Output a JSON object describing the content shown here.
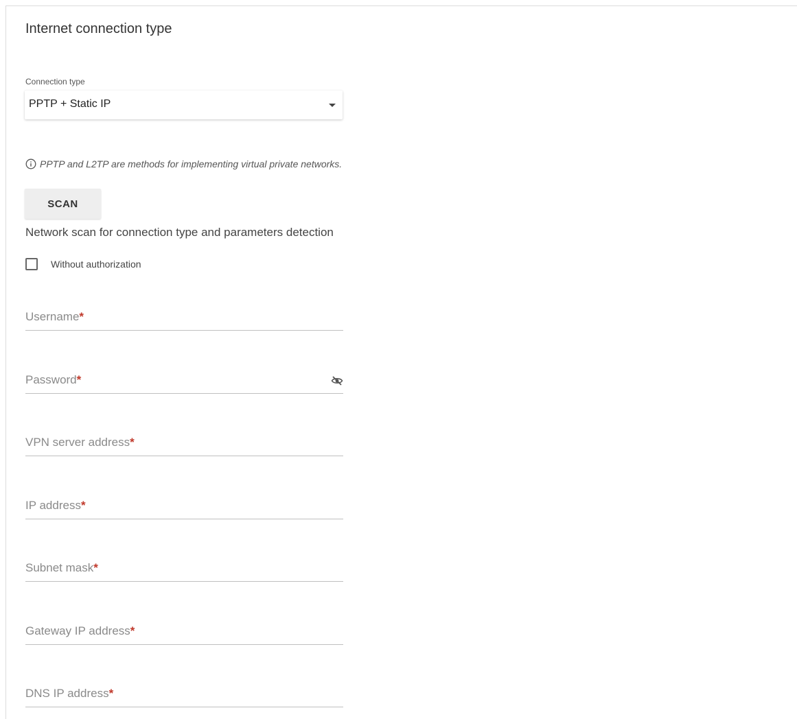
{
  "section": {
    "title": "Internet connection type"
  },
  "connection_type": {
    "label": "Connection type",
    "selected": "PPTP + Static IP"
  },
  "info": {
    "text": "PPTP and L2TP are methods for implementing virtual private networks."
  },
  "scan": {
    "button_label": "SCAN",
    "description": "Network scan for connection type and parameters detection"
  },
  "without_authorization": {
    "label": "Without authorization",
    "checked": false
  },
  "fields": [
    {
      "label": "Username",
      "required_mark": "*"
    },
    {
      "label": "Password",
      "required_mark": "*"
    },
    {
      "label": "VPN server address",
      "required_mark": "*"
    },
    {
      "label": "IP address",
      "required_mark": "*"
    },
    {
      "label": "Subnet mask",
      "required_mark": "*"
    },
    {
      "label": "Gateway IP address",
      "required_mark": "*"
    },
    {
      "label": "DNS IP address",
      "required_mark": "*"
    }
  ],
  "colors": {
    "required": "#c0392b",
    "button_bg": "#eeeeee",
    "underline": "#bfbfbf"
  },
  "icons": {
    "info": "info-circle-icon",
    "password_toggle": "eye-off-icon",
    "dropdown": "caret-down-icon"
  }
}
